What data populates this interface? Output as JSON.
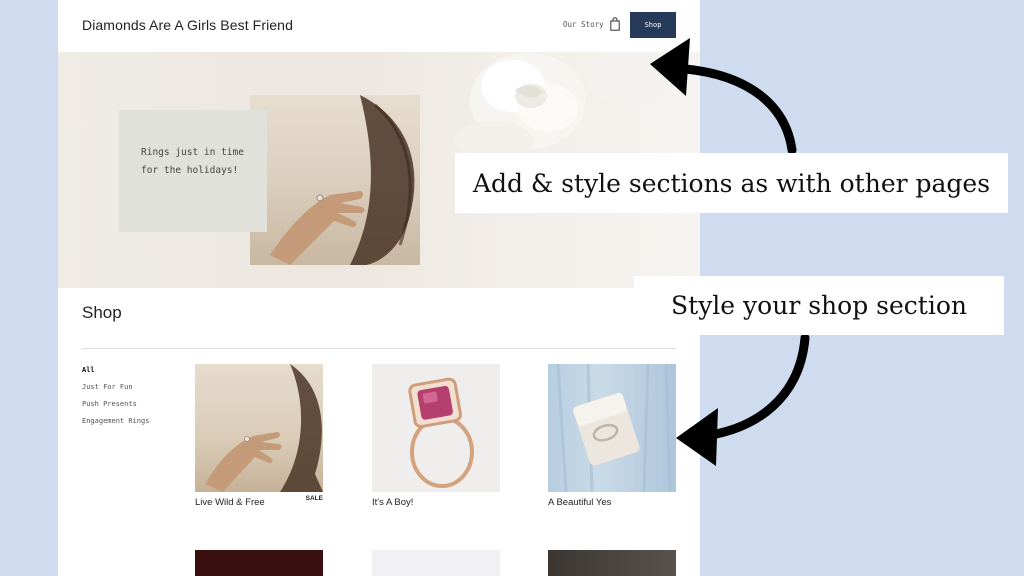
{
  "header": {
    "site_title": "Diamonds Are A Girls Best Friend",
    "nav_link": "Our Story",
    "cart_icon": "shopping-bag-icon",
    "shop_button": "Shop",
    "accent_color": "#283a5c"
  },
  "hero": {
    "card_text": "Rings just in time for the holidays!"
  },
  "shop": {
    "heading": "Shop",
    "categories": [
      "All",
      "Just For Fun",
      "Push Presents",
      "Engagement Rings"
    ],
    "active_category": "All",
    "products": [
      {
        "name": "Live Wild & Free",
        "badge": "SALE"
      },
      {
        "name": "It's A Boy!",
        "badge": ""
      },
      {
        "name": "A Beautiful Yes",
        "badge": ""
      }
    ]
  },
  "annotations": {
    "top": "Add & style sections as with other pages",
    "bottom": "Style your shop section"
  },
  "colors": {
    "page_background": "#cfdcef",
    "shop_button": "#283a5c"
  }
}
